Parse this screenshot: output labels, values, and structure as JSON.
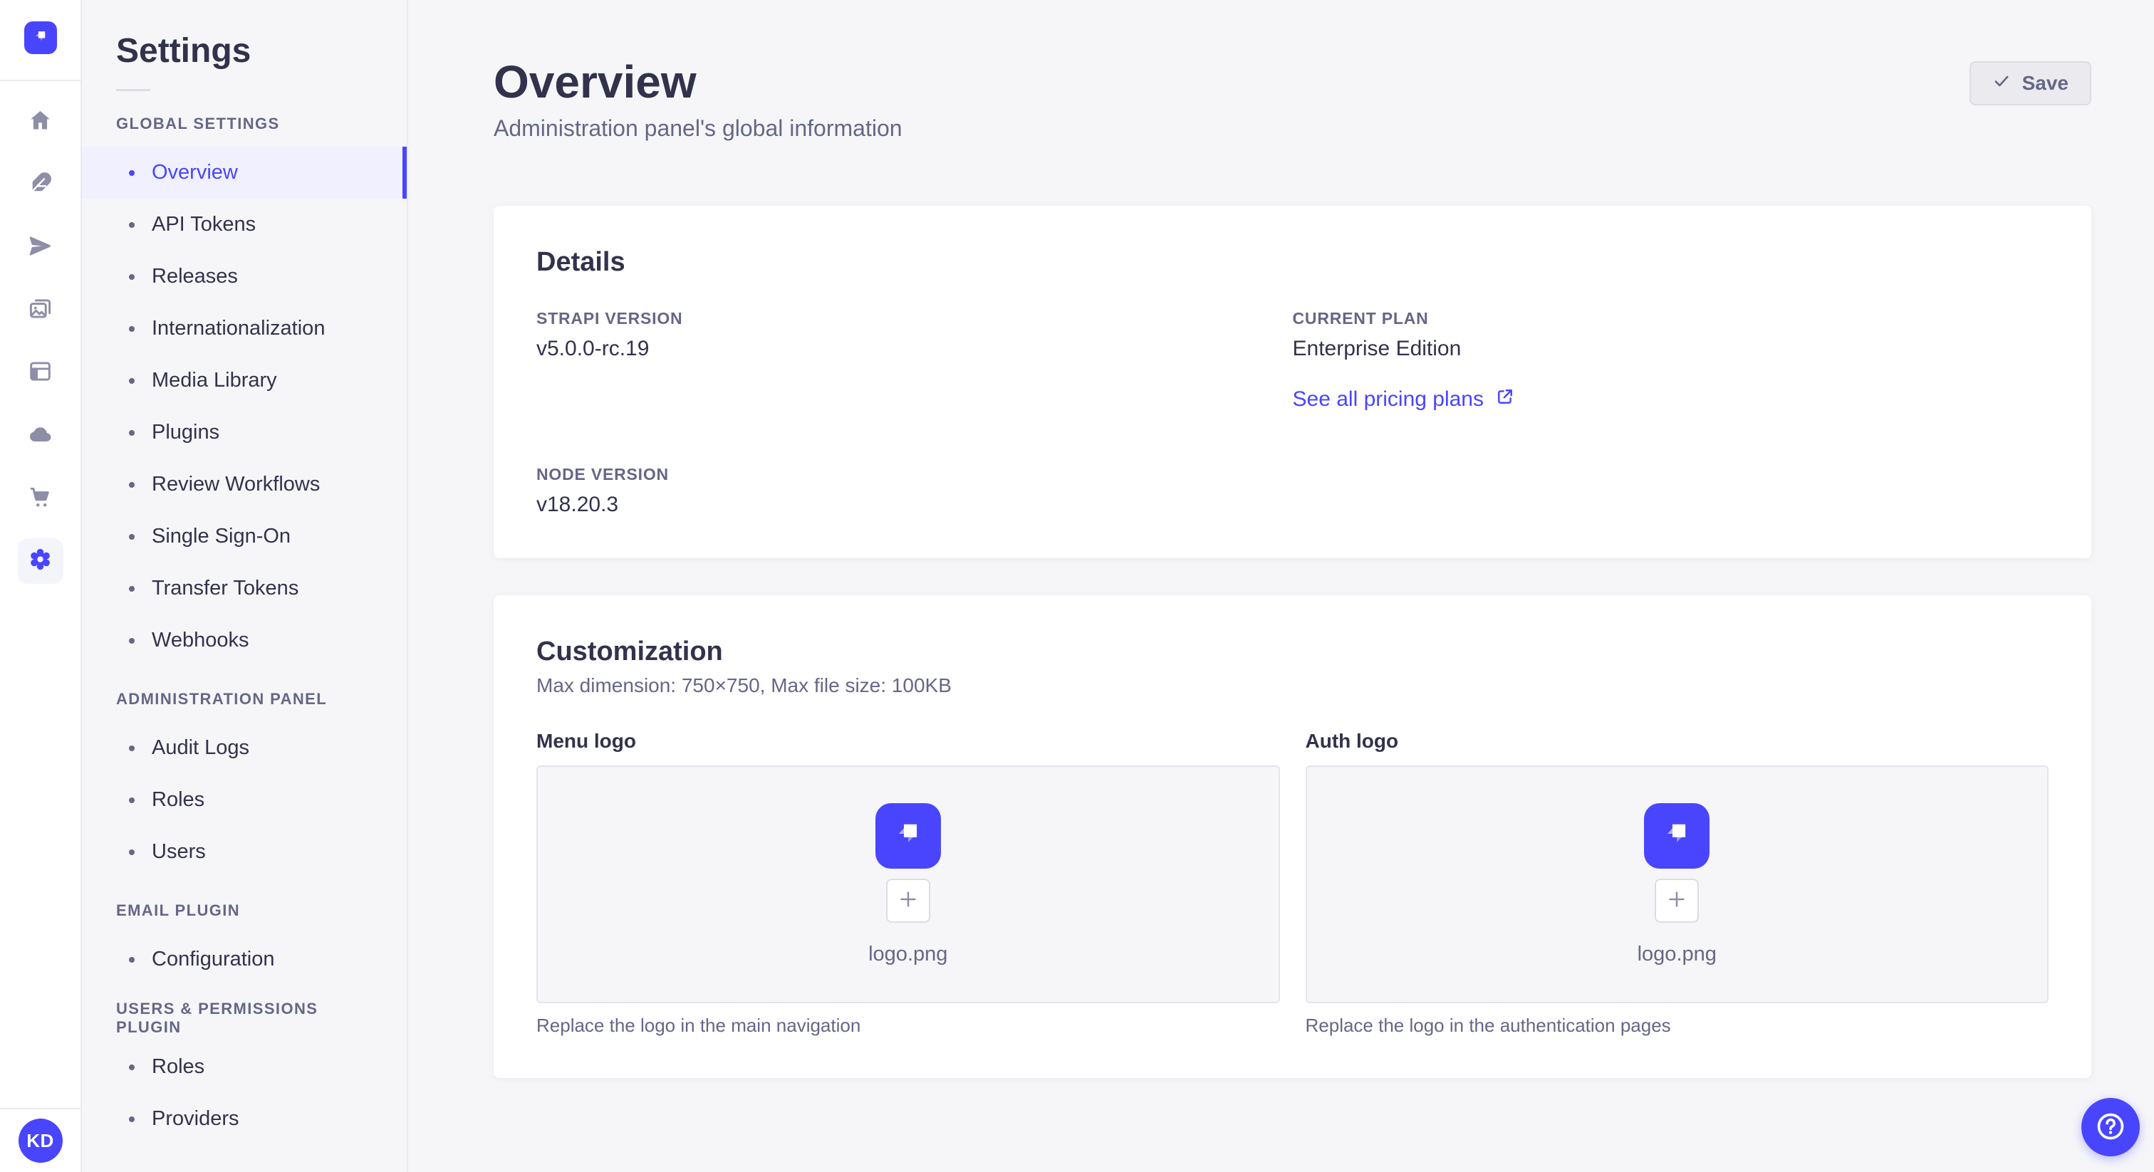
{
  "colors": {
    "accent": "#4945ff",
    "accent_active_bg": "#f0f0ff",
    "text_dark": "#32324d",
    "text_gray": "#666687",
    "icon_gray": "#8e8ea9",
    "border": "#eaeaef",
    "page_bg": "#f6f6f9",
    "card_bg": "#ffffff"
  },
  "rail": {
    "logo_icon": "strapi-logo",
    "items": [
      {
        "name": "home",
        "icon": "home-icon",
        "active": false
      },
      {
        "name": "content",
        "icon": "feather-icon",
        "active": false
      },
      {
        "name": "releases",
        "icon": "send-icon",
        "active": false
      },
      {
        "name": "media-library",
        "icon": "media-icon",
        "active": false
      },
      {
        "name": "content-manager",
        "icon": "layout-icon",
        "active": false
      },
      {
        "name": "deploy",
        "icon": "cloud-icon",
        "active": false
      },
      {
        "name": "marketplace",
        "icon": "cart-icon",
        "active": false
      },
      {
        "name": "settings",
        "icon": "gear-icon",
        "active": true
      }
    ],
    "avatar_initials": "KD"
  },
  "subnav": {
    "title": "Settings",
    "sections": [
      {
        "label": "Global Settings",
        "items": [
          {
            "label": "Overview",
            "active": true
          },
          {
            "label": "API Tokens",
            "active": false
          },
          {
            "label": "Releases",
            "active": false
          },
          {
            "label": "Internationalization",
            "active": false
          },
          {
            "label": "Media Library",
            "active": false
          },
          {
            "label": "Plugins",
            "active": false
          },
          {
            "label": "Review Workflows",
            "active": false
          },
          {
            "label": "Single Sign-On",
            "active": false
          },
          {
            "label": "Transfer Tokens",
            "active": false
          },
          {
            "label": "Webhooks",
            "active": false
          }
        ]
      },
      {
        "label": "Administration Panel",
        "items": [
          {
            "label": "Audit Logs",
            "active": false
          },
          {
            "label": "Roles",
            "active": false
          },
          {
            "label": "Users",
            "active": false
          }
        ]
      },
      {
        "label": "Email Plugin",
        "items": [
          {
            "label": "Configuration",
            "active": false
          }
        ]
      },
      {
        "label": "Users & Permissions plugin",
        "items": [
          {
            "label": "Roles",
            "active": false
          },
          {
            "label": "Providers",
            "active": false
          }
        ]
      }
    ]
  },
  "header": {
    "title": "Overview",
    "subtitle": "Administration panel's global information",
    "save_label": "Save",
    "save_icon": "check-icon"
  },
  "details": {
    "heading": "Details",
    "fields": [
      {
        "label": "STRAPI VERSION",
        "value": "v5.0.0-rc.19"
      },
      {
        "label": "CURRENT PLAN",
        "value": "Enterprise Edition"
      },
      {
        "label": "NODE VERSION",
        "value": "v18.20.3"
      }
    ],
    "link": {
      "label": "See all pricing plans",
      "icon": "external-link-icon"
    }
  },
  "customization": {
    "heading": "Customization",
    "subheading": "Max dimension: 750×750, Max file size: 100KB",
    "uploaders": [
      {
        "label": "Menu logo",
        "filename": "logo.png",
        "hint": "Replace the logo in the main navigation",
        "logo_icon": "strapi-logo",
        "add_icon": "plus-icon"
      },
      {
        "label": "Auth logo",
        "filename": "logo.png",
        "hint": "Replace the logo in the authentication pages",
        "logo_icon": "strapi-logo",
        "add_icon": "plus-icon"
      }
    ]
  },
  "fab": {
    "icon": "question-icon"
  }
}
